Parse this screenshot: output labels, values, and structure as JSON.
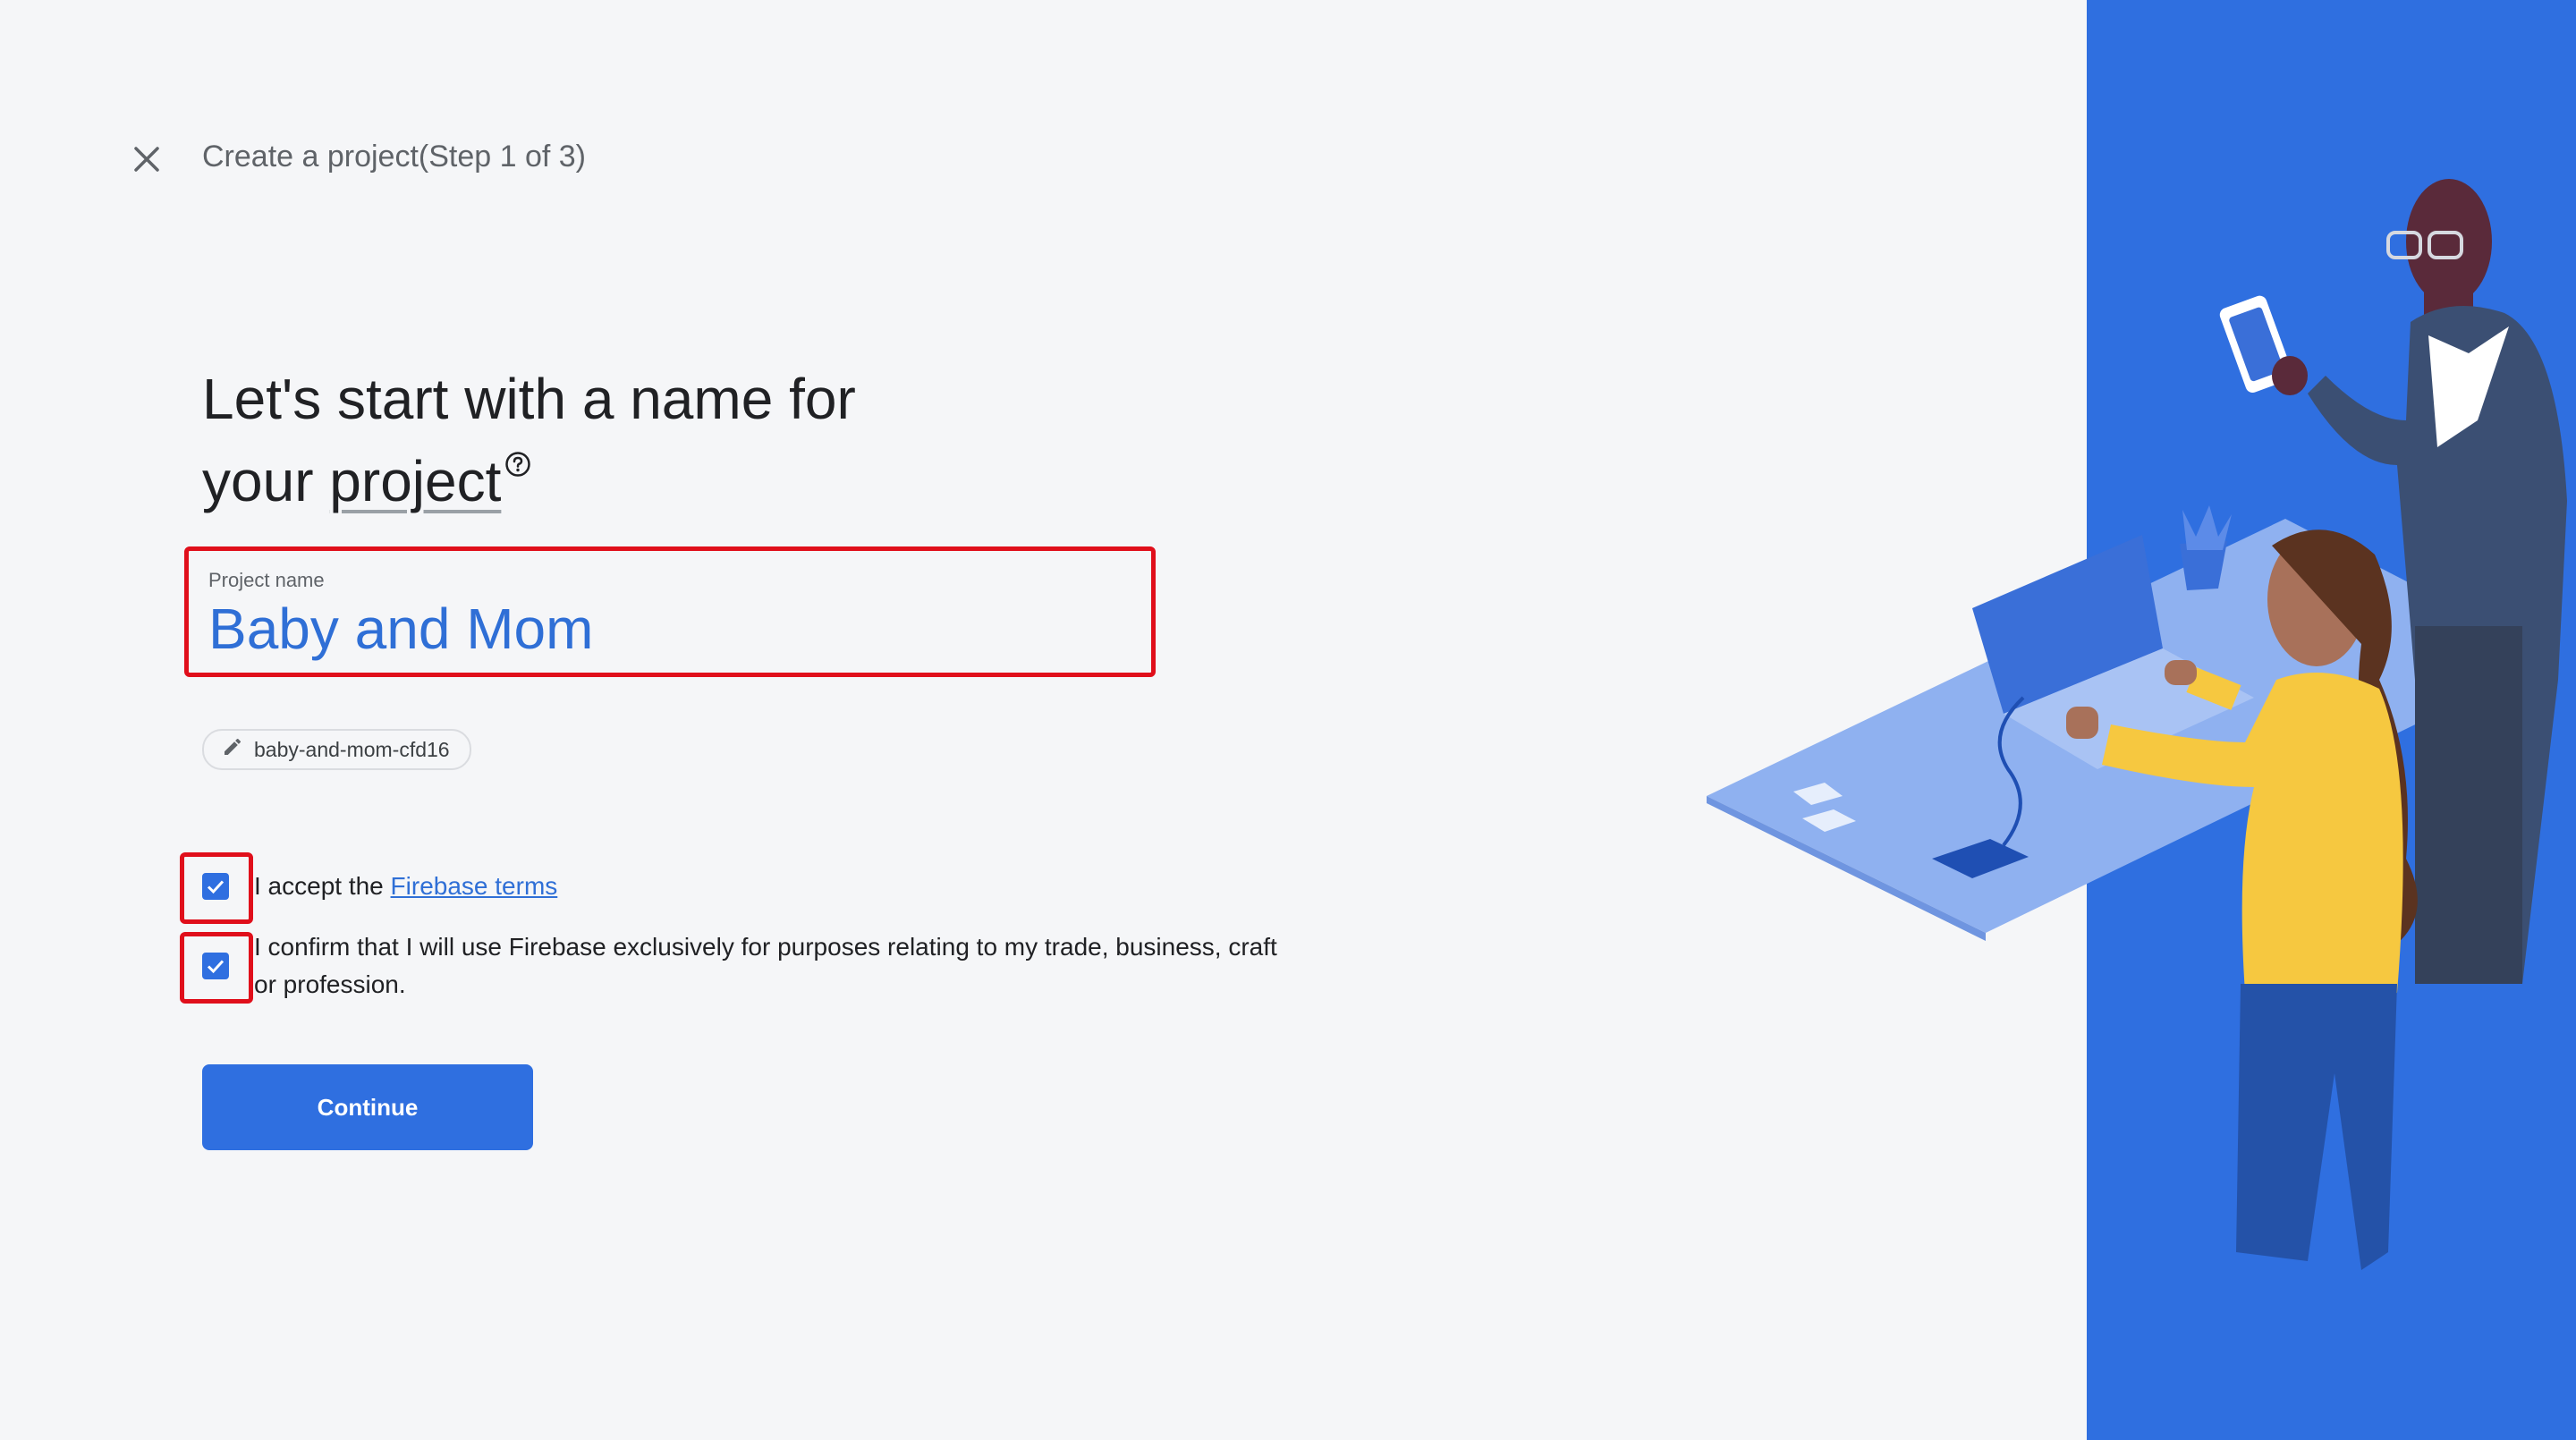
{
  "header": {
    "close_icon": "close-icon",
    "title": "Create a project(Step 1 of 3)"
  },
  "heading": {
    "line1": "Let's start with a name for",
    "line2_prefix": "your ",
    "line2_project": "project",
    "help_icon": "help-circle-icon"
  },
  "project_name": {
    "label": "Project name",
    "value": "Baby and Mom"
  },
  "project_id": {
    "icon": "pencil-icon",
    "value": "baby-and-mom-cfd16"
  },
  "checks": {
    "terms": {
      "checked": true,
      "prefix": "I accept the ",
      "link": "Firebase terms"
    },
    "confirm": {
      "checked": true,
      "line1": "I confirm that I will use Firebase exclusively for purposes relating to my trade, business, craft",
      "line2": "or profession."
    }
  },
  "continue_label": "Continue",
  "colors": {
    "accent": "#2f6fe0",
    "highlight": "#e00f1b",
    "link": "#2f6fd6",
    "background": "#f5f6f8"
  },
  "illustration": "people-working-at-desk-illustration"
}
